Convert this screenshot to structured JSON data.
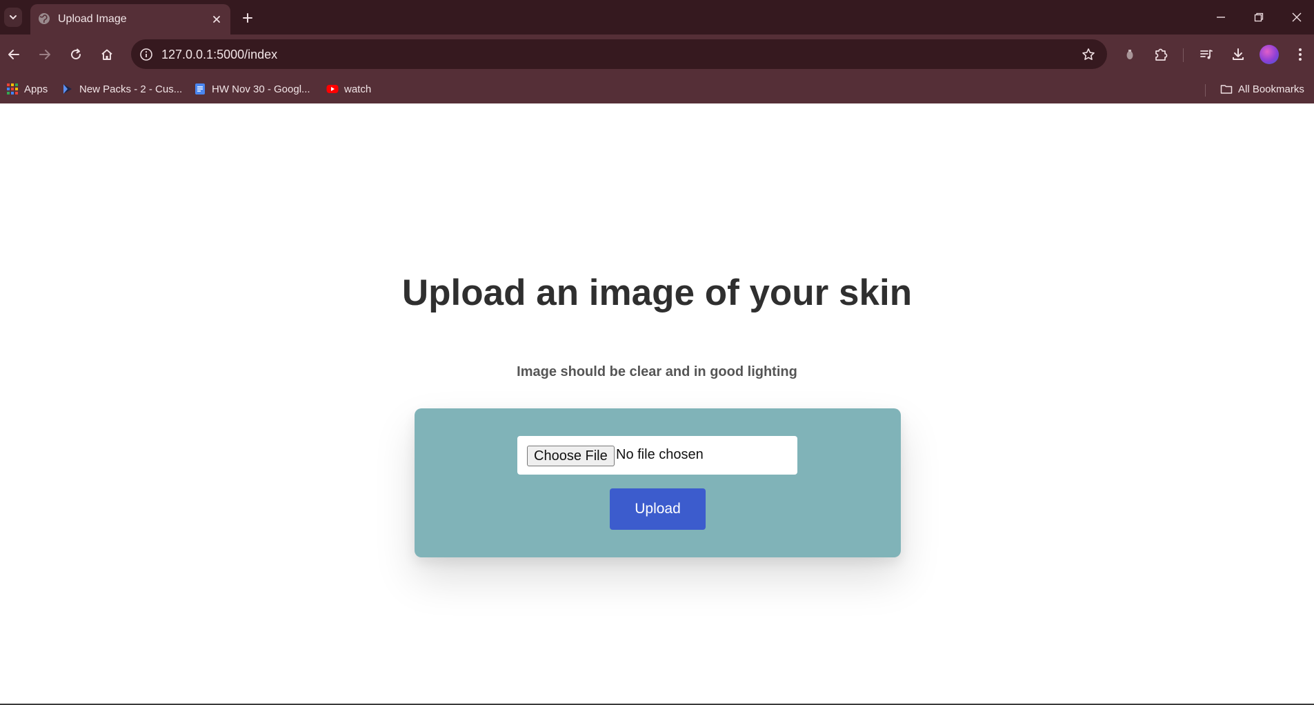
{
  "browser": {
    "tab": {
      "title": "Upload Image"
    },
    "address": {
      "url": "127.0.0.1:5000/index"
    },
    "bookmarks": [
      {
        "label": "Apps",
        "icon": "apps-grid-icon"
      },
      {
        "label": "New Packs - 2 - Cus...",
        "icon": "play-triangle-icon"
      },
      {
        "label": "HW Nov 30 - Googl...",
        "icon": "google-docs-icon"
      },
      {
        "label": "watch",
        "icon": "youtube-icon"
      }
    ],
    "all_bookmarks": "All Bookmarks",
    "colors": {
      "tabstrip": "#35191f",
      "toolbar": "#552f37"
    }
  },
  "page": {
    "title": "Upload an image of your skin",
    "subtitle": "Image should be clear and in good lighting",
    "file_input": {
      "button_label": "Choose File",
      "status": "No file chosen"
    },
    "upload_button": "Upload",
    "colors": {
      "card": "#80b3b8",
      "button": "#3c5ccd",
      "title": "#2f2f2f"
    }
  }
}
